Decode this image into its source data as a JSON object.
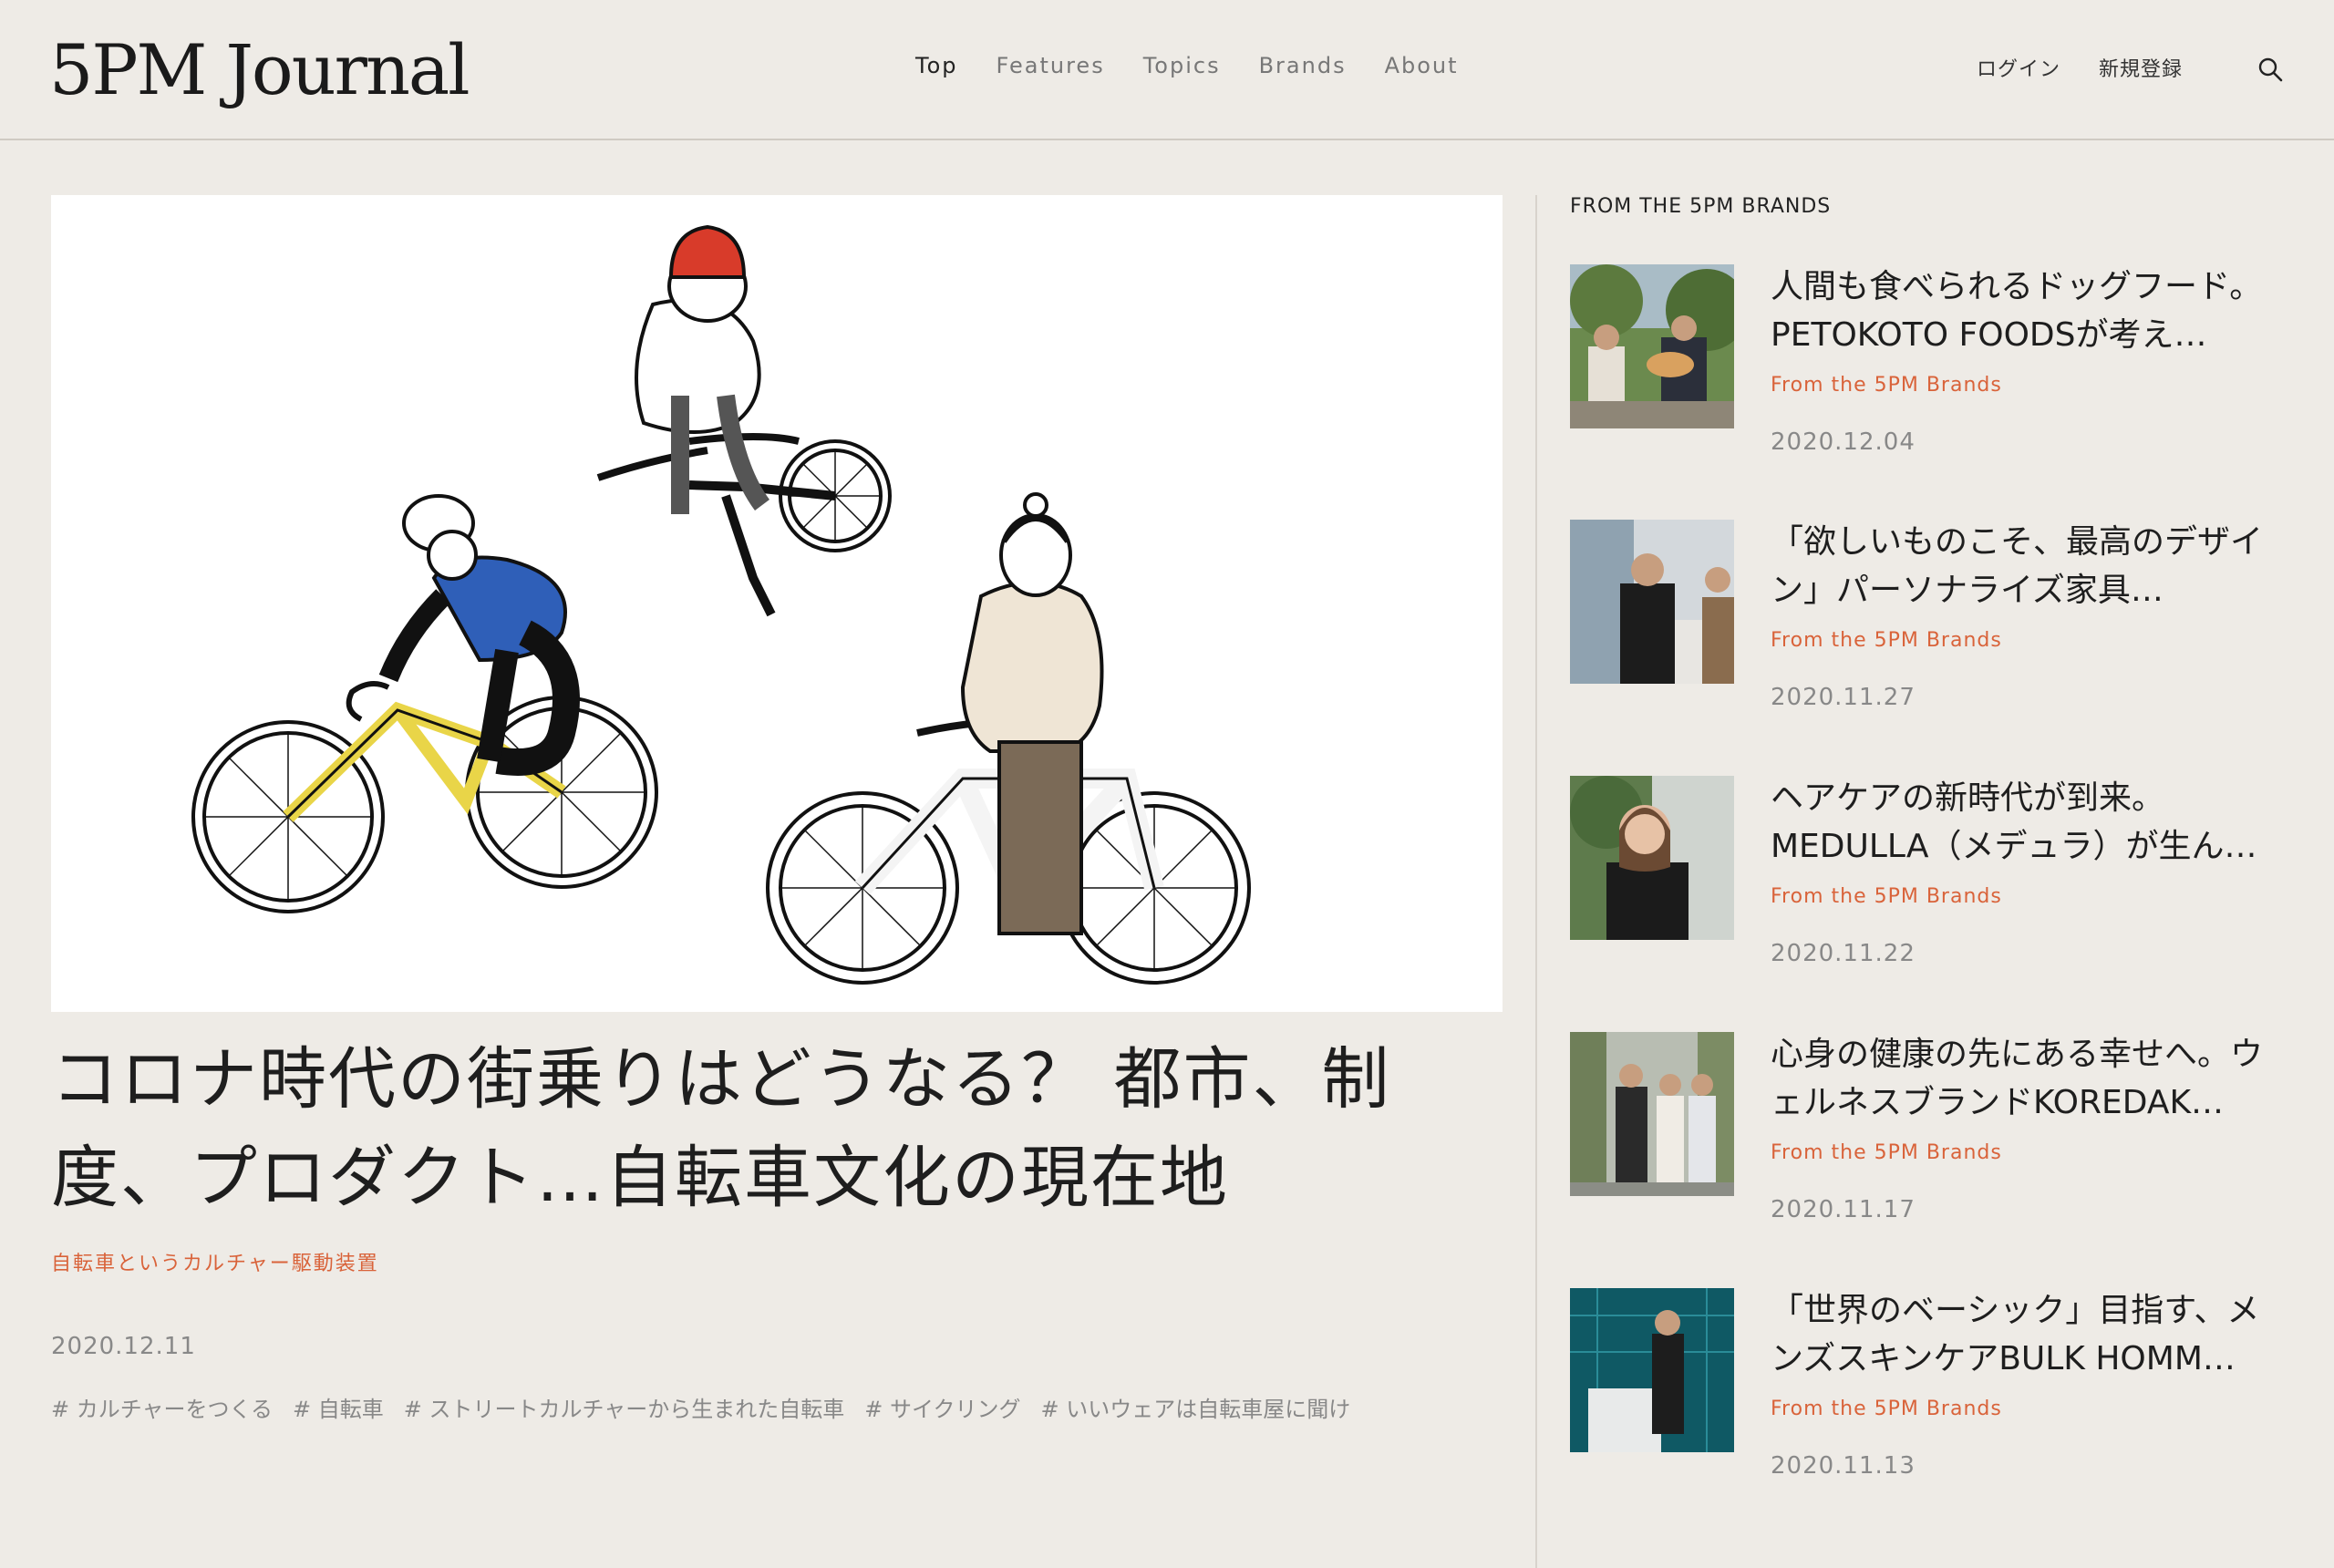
{
  "header": {
    "logo": "5PM Journal",
    "nav": [
      {
        "label": "Top"
      },
      {
        "label": "Features"
      },
      {
        "label": "Topics"
      },
      {
        "label": "Brands"
      },
      {
        "label": "About"
      }
    ],
    "login": "ログイン",
    "signup": "新規登録"
  },
  "main": {
    "title": "コロナ時代の街乗りはどうなる？ 都市、制度、プロダクト…自転車文化の現在地",
    "series": "自転車というカルチャー駆動装置",
    "date": "2020.12.11",
    "tags": [
      "# カルチャーをつくる",
      "# 自転車",
      "# ストリートカルチャーから生まれた自転車",
      "# サイクリング",
      "# いいウェアは自転車屋に聞け"
    ]
  },
  "sidebar": {
    "heading": "FROM THE 5PM BRANDS",
    "items": [
      {
        "title": "人間も食べられるドッグフード。PETOKOTO FOODSが考え…",
        "category": "From the 5PM Brands",
        "date": "2020.12.04"
      },
      {
        "title": "「欲しいものこそ、最高のデザイン」パーソナライズ家具…",
        "category": "From the 5PM Brands",
        "date": "2020.11.27"
      },
      {
        "title": "ヘアケアの新時代が到来。MEDULLA（メデュラ）が生ん…",
        "category": "From the 5PM Brands",
        "date": "2020.11.22"
      },
      {
        "title": "心身の健康の先にある幸せへ。ウェルネスブランドKOREDAK…",
        "category": "From the 5PM Brands",
        "date": "2020.11.17"
      },
      {
        "title": "「世界のベーシック」目指す、メンズスキンケアBULK HOMM…",
        "category": "From the 5PM Brands",
        "date": "2020.11.13"
      }
    ]
  },
  "colors": {
    "background": "#eeebe6",
    "accent": "#d9633a",
    "muted": "#888888"
  }
}
